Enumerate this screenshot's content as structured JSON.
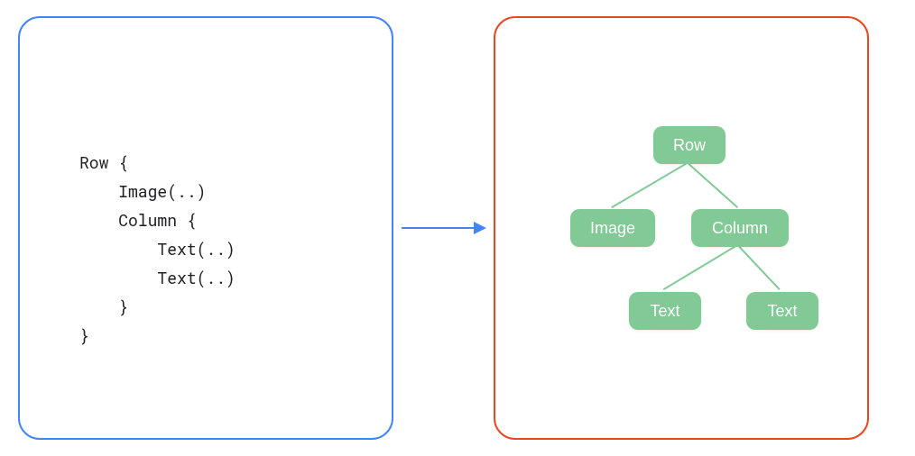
{
  "code": {
    "lines": [
      "Row {",
      "    Image(..)",
      "    Column {",
      "        Text(..)",
      "        Text(..)",
      "    }",
      "}"
    ]
  },
  "tree": {
    "root": "Row",
    "child1": "Image",
    "child2": "Column",
    "grand1": "Text",
    "grand2": "Text"
  },
  "colors": {
    "left_border": "#4285F4",
    "right_border": "#E8481F",
    "arrow": "#4285F4",
    "node_bg": "#81C995",
    "node_text": "#ffffff"
  }
}
